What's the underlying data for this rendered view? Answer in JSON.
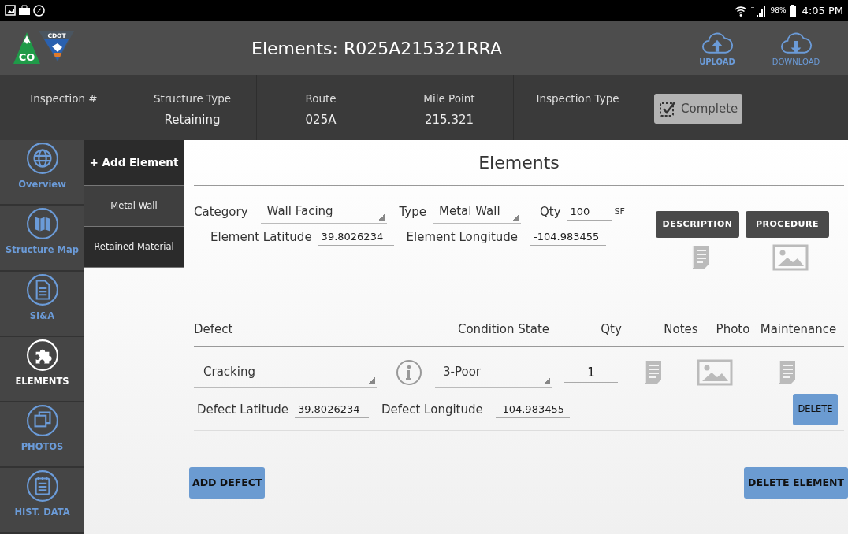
{
  "status_bar": {
    "battery": "98%",
    "time": "4:05 PM"
  },
  "header": {
    "logo": {
      "mark": "CO",
      "agency": "CDOT"
    },
    "title": "Elements: R025A215321RRA",
    "actions": [
      {
        "label": "UPLOAD",
        "kind": "upload"
      },
      {
        "label": "DOWNLOAD",
        "kind": "download"
      }
    ]
  },
  "info": {
    "fields": [
      {
        "label": "Inspection #"
      },
      {
        "label": "Structure Type",
        "value": "Retaining"
      },
      {
        "label": "Route",
        "value": "025A"
      },
      {
        "label": "Mile Point",
        "value": "215.321"
      },
      {
        "label": "Inspection Type"
      }
    ],
    "complete_button": "Complete"
  },
  "nav": [
    {
      "label": "Overview",
      "kind": "globe",
      "selected": false
    },
    {
      "label": "Structure Map",
      "kind": "map",
      "selected": false
    },
    {
      "label": "SI&A",
      "kind": "document",
      "selected": false
    },
    {
      "label": "ELEMENTS",
      "kind": "puzzle",
      "selected": true
    },
    {
      "label": "PHOTOS",
      "kind": "photos",
      "selected": false
    },
    {
      "label": "HIST. DATA",
      "kind": "notepad",
      "selected": false
    }
  ],
  "element_list": {
    "add": "+ Add Element",
    "items": [
      {
        "label": "Metal Wall",
        "selected": true
      },
      {
        "label": "Retained Material",
        "selected": false
      }
    ]
  },
  "element": {
    "heading": "Elements",
    "category_label": "Category",
    "category": "Wall Facing",
    "type_label": "Type",
    "type": "Metal Wall",
    "qty_label": "Qty",
    "qty": "100",
    "unit": "SF",
    "lat_label": "Element Latitude",
    "lat": "39.8026234",
    "lon_label": "Element Longitude",
    "lon": "-104.983455",
    "buttons": [
      "DESCRIPTION",
      "PROCEDURE"
    ]
  },
  "defects": {
    "columns": [
      "Defect",
      "Condition State",
      "Qty",
      "Notes",
      "Photo",
      "Maintenance"
    ],
    "rows": [
      {
        "defect": "Cracking",
        "condition": "3-Poor",
        "qty": "1",
        "lat_label": "Defect Latitude",
        "lat": "39.8026234",
        "lon_label": "Defect Longitude",
        "lon": "-104.983455",
        "delete": "DELETE"
      }
    ]
  },
  "add_defect": "ADD DEFECT",
  "delete_element": "DELETE ELEMENT"
}
